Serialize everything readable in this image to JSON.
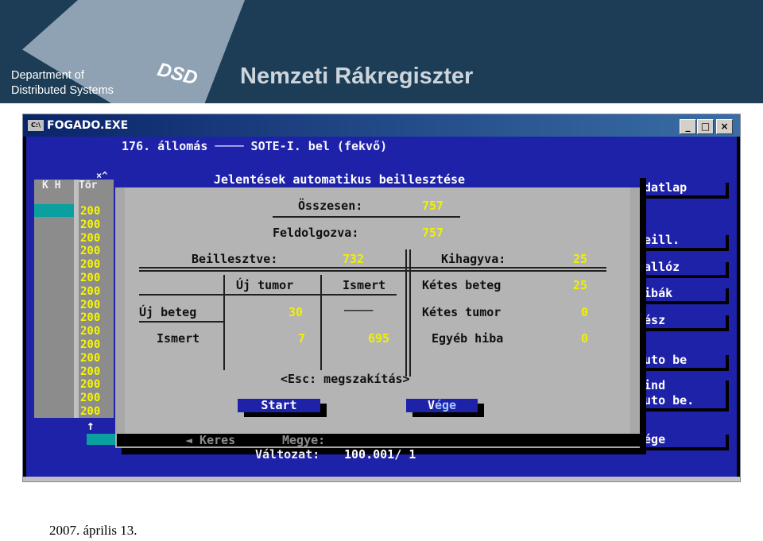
{
  "slide": {
    "dept_line1": "Department of",
    "dept_line2": "Distributed Systems",
    "logo": "DSD",
    "title": "Nemzeti Rákregiszter",
    "date": "2007. április 13."
  },
  "window": {
    "title": "FOGADO.EXE",
    "icon_label": "C:\\",
    "minimize": "_",
    "maximize": "□",
    "close": "×"
  },
  "screen": {
    "status_line": "176. állomás ──── SOTE-I. bel (fekvő)",
    "left_headers": {
      "kh": "K H",
      "tor": "Tör"
    },
    "top_mark": "×^",
    "codes": [
      "200",
      "200",
      "200",
      "200",
      "200",
      "200",
      "200",
      "200",
      "200",
      "200",
      "200",
      "200",
      "200",
      "200",
      "200",
      "200"
    ],
    "up_arrow": "↑",
    "keres": "◄ Keres",
    "megye": "Megye:",
    "valtozat_label": "Változat:",
    "valtozat_value": "100.001/ 1"
  },
  "menu": {
    "items": [
      {
        "label": "Adatlap"
      },
      {
        "label": "Beill."
      },
      {
        "label": "Tallóz"
      },
      {
        "label": "Hibák"
      },
      {
        "label": "Kész"
      },
      {
        "label": "Auto be"
      },
      {
        "label": "Mind"
      },
      {
        "label": "auto be."
      },
      {
        "label": "Vége"
      }
    ]
  },
  "dialog": {
    "title": "Jelentések automatikus beillesztése",
    "osszesen_label": "Összesen:",
    "osszesen_value": "757",
    "feldolgozva_label": "Feldolgozva:",
    "feldolgozva_value": "757",
    "beillesztve_label": "Beillesztve:",
    "beillesztve_value": "732",
    "kihagyva_label": "Kihagyva:",
    "kihagyva_value": "25",
    "col_uj_tumor": "Új tumor",
    "col_ismert": "Ismert",
    "row_uj_beteg": "Új beteg",
    "row_ismert": "Ismert",
    "uj_beteg_uj_tumor": "30",
    "uj_beteg_ismert": "────",
    "ismert_uj_tumor": "7",
    "ismert_ismert": "695",
    "ketes_beteg_label": "Kétes beteg",
    "ketes_beteg_value": "25",
    "ketes_tumor_label": "Kétes tumor",
    "ketes_tumor_value": "0",
    "egyeb_hiba_label": "Egyéb hiba",
    "egyeb_hiba_value": "0",
    "esc_hint": "<Esc: megszakítás>",
    "start_button": "Start",
    "vege_button_v": "V",
    "vege_button_rest": "ége"
  }
}
